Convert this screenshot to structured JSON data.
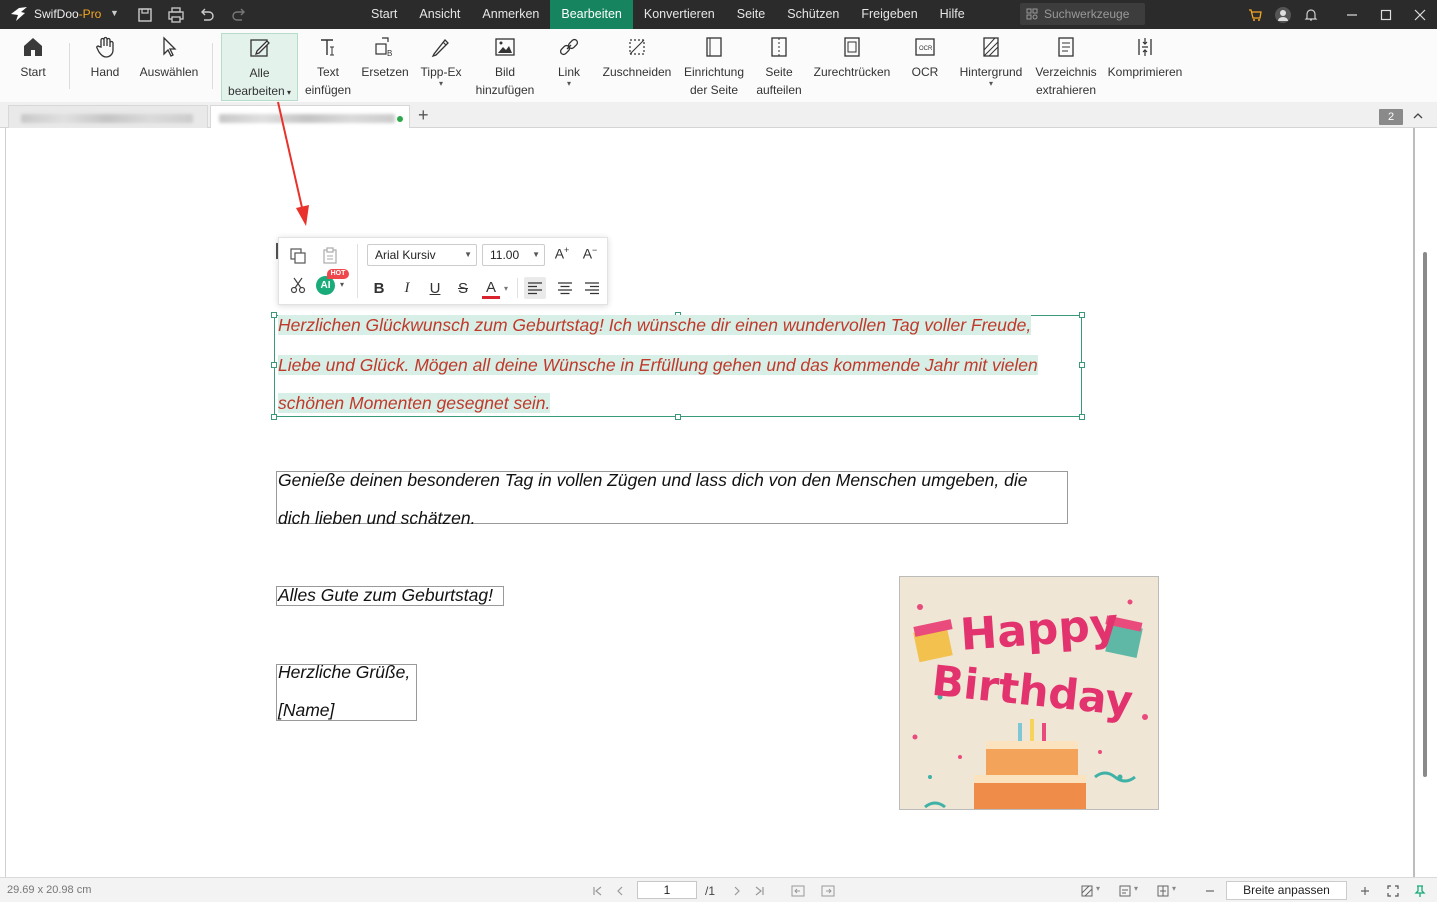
{
  "app": {
    "name": "SwifDoo",
    "edition": "-Pro"
  },
  "menu": [
    {
      "label": "Start"
    },
    {
      "label": "Ansicht"
    },
    {
      "label": "Anmerken"
    },
    {
      "label": "Bearbeiten",
      "active": true
    },
    {
      "label": "Konvertieren"
    },
    {
      "label": "Seite"
    },
    {
      "label": "Schützen"
    },
    {
      "label": "Freigeben"
    },
    {
      "label": "Hilfe"
    }
  ],
  "search": {
    "placeholder": "Suchwerkzeuge"
  },
  "ribbon": {
    "start": "Start",
    "hand": "Hand",
    "select": "Auswählen",
    "edit_all_1": "Alle",
    "edit_all_2": "bearbeiten",
    "text_1": "Text",
    "text_2": "einfügen",
    "replace": "Ersetzen",
    "typo": "Tipp-Ex",
    "image_1": "Bild",
    "image_2": "hinzufügen",
    "link": "Link",
    "crop": "Zuschneiden",
    "page_setup_1": "Einrichtung",
    "page_setup_2": "der Seite",
    "split_1": "Seite",
    "split_2": "aufteilen",
    "deskew": "Zurechtrücken",
    "ocr": "OCR",
    "background": "Hintergrund",
    "toc_1": "Verzeichnis",
    "toc_2": "extrahieren",
    "compress": "Komprimieren"
  },
  "tabs": {
    "page_count": "2"
  },
  "float_toolbar": {
    "font": "Arial Kursiv",
    "size": "11.00",
    "ai": "AI",
    "hot": "HOT"
  },
  "document": {
    "selected_lines": [
      "Herzlichen Glückwunsch zum Geburtstag! Ich wünsche dir einen wundervollen Tag voller Freude,",
      "Liebe und Glück. Mögen all deine Wünsche in Erfüllung gehen und das kommende Jahr mit vielen",
      "schönen Momenten gesegnet sein."
    ],
    "para2": [
      "Genieße deinen besonderen Tag in vollen Zügen und lass dich von den Menschen umgeben, die",
      "dich lieben und schätzen."
    ],
    "para3": "Alles Gute zum Geburtstag!",
    "closing": [
      "Herzliche Grüße,",
      "[Name]"
    ],
    "image_text": [
      "Happy",
      "Birthday"
    ]
  },
  "statusbar": {
    "dimensions": "29.69 x 20.98 cm",
    "page": "1",
    "total": "/1",
    "fit": "Breite anpassen"
  },
  "colors": {
    "accent": "#16845e",
    "selected_text": "#c0392b",
    "highlight": "#d7efe6"
  }
}
